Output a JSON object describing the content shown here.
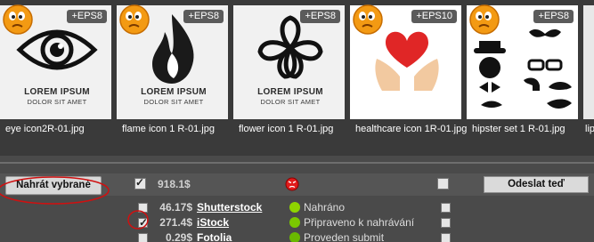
{
  "gallery": {
    "items": [
      {
        "filename": "eye icon2R-01.jpg",
        "badge": "+EPS8",
        "caption": "LOREM IPSUM",
        "subcaption": "DOLOR SIT AMET",
        "icon": "eye-icon"
      },
      {
        "filename": "flame icon 1 R-01.jpg",
        "badge": "+EPS8",
        "caption": "LOREM IPSUM",
        "subcaption": "DOLOR SIT AMET",
        "icon": "flame-icon"
      },
      {
        "filename": "flower icon 1 R-01.jpg",
        "badge": "+EPS8",
        "caption": "LOREM IPSUM",
        "subcaption": "DOLOR SIT AMET",
        "icon": "flower-icon"
      },
      {
        "filename": "healthcare icon 1R-01.jpg",
        "badge": "+EPS10",
        "caption": "",
        "subcaption": "",
        "icon": "heart-hands-icon"
      },
      {
        "filename": "hipster set 1 R-01.jpg",
        "badge": "+EPS8",
        "caption": "",
        "subcaption": "",
        "icon": "hipster-set-icon"
      },
      {
        "filename": "lip",
        "badge": "",
        "caption": "",
        "subcaption": "",
        "icon": "partial-thumbnail"
      }
    ]
  },
  "upload": {
    "upload_selected_label": "Nahrát vybrané",
    "total": "918.1$",
    "send_now_label": "Odeslat teď",
    "agencies": [
      {
        "price": "46.17$",
        "name": "Shutterstock",
        "status": "Nahráno",
        "status_color": "#8fd400",
        "checked": false
      },
      {
        "price": "271.4$",
        "name": "iStock",
        "status": "Připraveno k nahrávání",
        "status_color": "#7bc800",
        "checked": true
      },
      {
        "price": "0.29$",
        "name": "Fotolia",
        "status": "Proveden submit",
        "status_color": "#6ab800",
        "checked": false
      }
    ]
  },
  "colors": {
    "background": "#4a4a4a",
    "annotation": "#d01010"
  }
}
